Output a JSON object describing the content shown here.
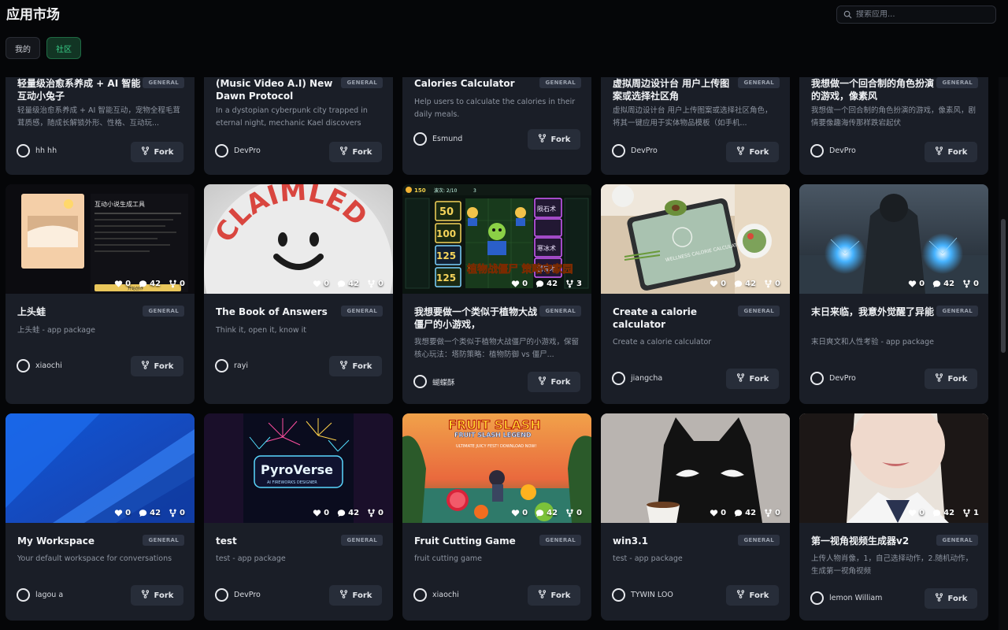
{
  "app": {
    "title": "应用市场"
  },
  "search": {
    "placeholder": "搜索应用..."
  },
  "tabs": [
    {
      "label": "我的",
      "active": false
    },
    {
      "label": "社区",
      "active": true
    }
  ],
  "fork_label": "Fork",
  "badge_label": "GENERAL",
  "colors": {
    "accent_green": "#39d08a",
    "card_bg": "#1a1e27",
    "page_bg": "#050608"
  },
  "cards": [
    {
      "title": "轻量级治愈系养成 + AI 智能互动小兔子",
      "badge": "GENERAL",
      "desc": "轻量级治愈系养成 + AI 智能互动，宠物全程毛茸茸质感，随成长解锁外形、性格、互动玩...",
      "author": "hh hh",
      "fork": "Fork"
    },
    {
      "title": "(Music Video A.I) New Dawn Protocol",
      "badge": "GENERAL",
      "desc": "In a dystopian cyberpunk city trapped in eternal night, mechanic Kael discovers the...",
      "author": "DevPro",
      "fork": "Fork"
    },
    {
      "title": "Calories Calculator",
      "badge": "GENERAL",
      "desc": "Help users to calculate the calories in their daily meals.",
      "author": "Esmund",
      "fork": "Fork"
    },
    {
      "title": "虚拟周边设计台 用户上传图案或选择社区角",
      "badge": "GENERAL",
      "desc": "虚拟周边设计台 用户上传图案或选择社区角色，将其一键应用于实体物品模板（如手机...",
      "author": "DevPro",
      "fork": "Fork"
    },
    {
      "title": "我想做一个回合制的角色扮演的游戏，像素风",
      "badge": "GENERAL",
      "desc": "我想做一个回合制的角色扮演的游戏，像素风，剧情要像趣海传那样跌宕起伏",
      "author": "DevPro",
      "fork": "Fork"
    },
    {
      "title": "上头蛙",
      "badge": "GENERAL",
      "desc": "上头蛙 - app package",
      "author": "xiaochi",
      "fork": "Fork",
      "likes": "0",
      "comments": "42",
      "forks": "0"
    },
    {
      "title": "The Book of Answers",
      "badge": "GENERAL",
      "desc": "Think it, open it, know it",
      "author": "rayi",
      "fork": "Fork",
      "likes": "0",
      "comments": "42",
      "forks": "0"
    },
    {
      "title": "我想要做一个类似于植物大战僵尸的小游戏，",
      "badge": "GENERAL",
      "desc": "我想要做一个类似于植物大战僵尸的小游戏，保留核心玩法：塔防策略：植物防御 vs 僵尸...",
      "author": "蝴蝶酥",
      "fork": "Fork",
      "likes": "0",
      "comments": "42",
      "forks": "3"
    },
    {
      "title": "Create a calorie calculator",
      "badge": "GENERAL",
      "desc": "Create a calorie calculator",
      "author": "jiangcha",
      "fork": "Fork",
      "likes": "0",
      "comments": "42",
      "forks": "0"
    },
    {
      "title": "末日来临，我意外觉醒了异能",
      "badge": "GENERAL",
      "desc": "末日爽文和人性考验 - app package",
      "author": "DevPro",
      "fork": "Fork",
      "likes": "0",
      "comments": "42",
      "forks": "0"
    },
    {
      "title": "My Workspace",
      "badge": "GENERAL",
      "desc": "Your default workspace for conversations",
      "author": "lagou a",
      "fork": "Fork",
      "likes": "0",
      "comments": "42",
      "forks": "0"
    },
    {
      "title": "test",
      "badge": "GENERAL",
      "desc": "test - app package",
      "author": "DevPro",
      "fork": "Fork",
      "likes": "0",
      "comments": "42",
      "forks": "0"
    },
    {
      "title": "Fruit Cutting Game",
      "badge": "GENERAL",
      "desc": "fruit cutting game",
      "author": "xiaochi",
      "fork": "Fork",
      "likes": "0",
      "comments": "42",
      "forks": "0"
    },
    {
      "title": "win3.1",
      "badge": "GENERAL",
      "desc": "test - app package",
      "author": "TYWIN LOO",
      "fork": "Fork",
      "likes": "0",
      "comments": "42",
      "forks": "0"
    },
    {
      "title": "第一视角视频生成器v2",
      "badge": "GENERAL",
      "desc": "上传人物肖像，1，自己选择动作，2.随机动作，生成第一视角视频",
      "author": "lemon William",
      "fork": "Fork",
      "likes": "0",
      "comments": "42",
      "forks": "1"
    }
  ],
  "thumb_text": {
    "c5": {
      "heading": "互动小说生成工具",
      "button": "开始创作"
    },
    "c6": {
      "word": "CLAIMLED"
    },
    "c7": {
      "sun": "150",
      "wave": "波次: 2/10",
      "coins": "3",
      "costs": [
        "50",
        "100",
        "125",
        "125"
      ],
      "right": [
        "陨石术",
        "寒冰术",
        "雷暴术"
      ],
      "title": "植物战僵尸 策略守家园"
    },
    "c8": {
      "label": "WELLNESS CALORIE CALCULATOR"
    },
    "c11": {
      "title": "PyroVerse",
      "sub": "AI FIREWORKS DESIGNER"
    },
    "c12": {
      "title": "FRUIT SLASH",
      "sub": "FRUIT SLASH LEGEND",
      "tag": "ULTIMATE JUICY FEST! DOWNLOAD NOW!"
    }
  }
}
